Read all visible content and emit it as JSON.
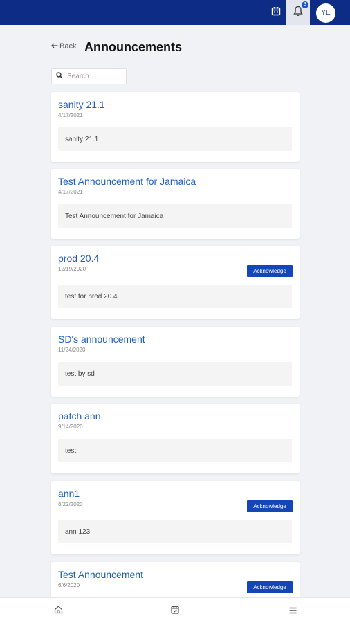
{
  "topbar": {
    "notification_count": "3",
    "avatar_initials": "YE"
  },
  "header": {
    "back_label": "Back",
    "title": "Announcements"
  },
  "search": {
    "placeholder": "Search"
  },
  "announcements": [
    {
      "title": "sanity 21.1",
      "date": "4/17/2021",
      "body": "sanity 21.1"
    },
    {
      "title": "Test Announcement for Jamaica",
      "date": "4/17/2021",
      "body": "Test Announcement for Jamaica"
    },
    {
      "title": "prod 20.4",
      "date": "12/19/2020",
      "body": "test for prod 20.4",
      "action": "Acknowledge"
    },
    {
      "title": "SD's announcement",
      "date": "11/24/2020",
      "body": "test by sd"
    },
    {
      "title": "patch ann",
      "date": "9/14/2020",
      "body": "test"
    },
    {
      "title": "ann1",
      "date": "8/22/2020",
      "body": "ann 123",
      "action": "Acknowledge"
    },
    {
      "title": "Test Announcement",
      "date": "6/6/2020",
      "action": "Acknowledge"
    }
  ],
  "colors": {
    "topbar": "#0d2c86",
    "accent": "#1546b8",
    "title_link": "#1f5fc1",
    "background": "#f1f2f6"
  },
  "icons": {
    "topbar": [
      "calendar-icon",
      "bell-icon"
    ],
    "bottomnav": [
      "home-icon",
      "calendar-check-icon",
      "menu-icon"
    ]
  }
}
